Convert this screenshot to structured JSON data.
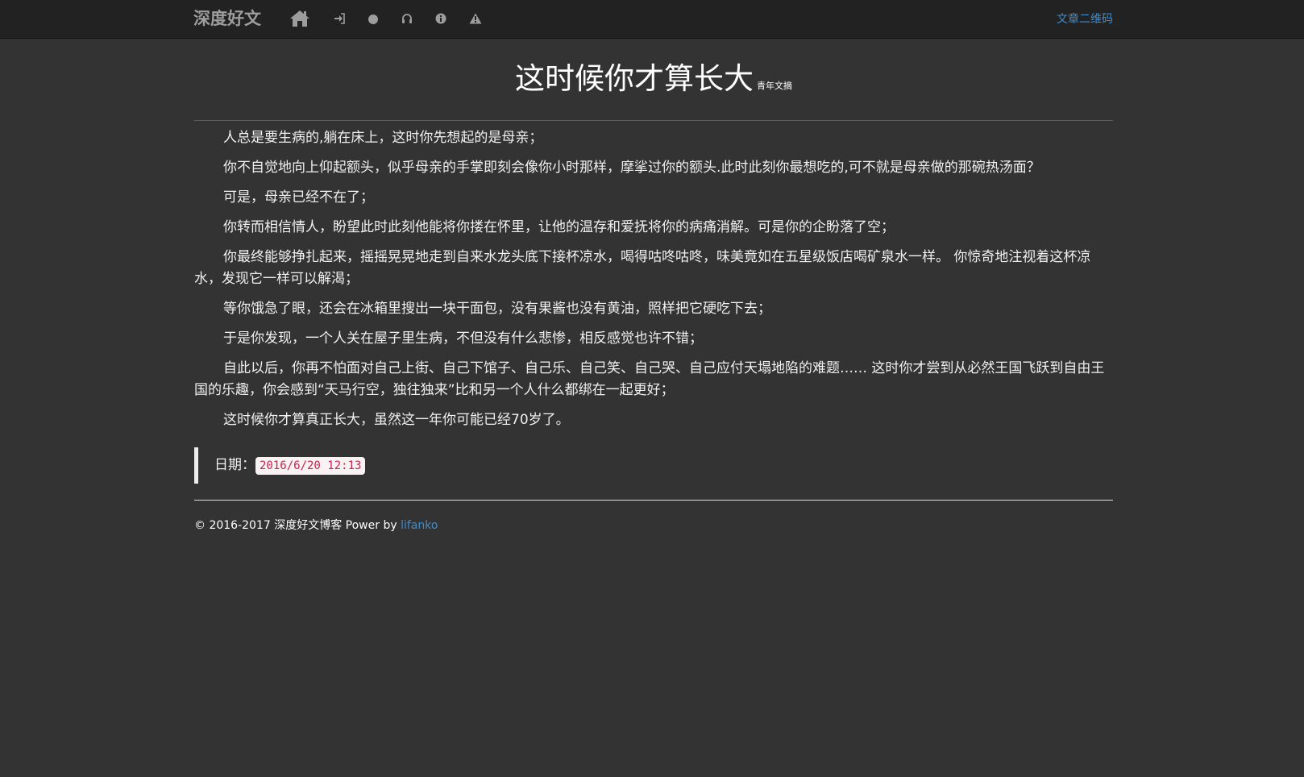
{
  "nav": {
    "brand": "深度好文",
    "icons": [
      "home-icon",
      "sign-in-icon",
      "circle-icon",
      "headphones-icon",
      "info-icon",
      "warning-icon"
    ],
    "right_link": "文章二维码"
  },
  "article": {
    "title": "这时候你才算长大",
    "source": "青年文摘",
    "paragraphs": [
      "人总是要生病的,躺在床上，这时你先想起的是母亲；",
      "你不自觉地向上仰起额头，似乎母亲的手掌即刻会像你小时那样，摩挲过你的额头.此时此刻你最想吃的,可不就是母亲做的那碗热汤面？",
      "可是，母亲已经不在了；",
      "你转而相信情人，盼望此时此刻他能将你搂在怀里，让他的温存和爱抚将你的病痛消解。可是你的企盼落了空；",
      "你最终能够挣扎起来，摇摇晃晃地走到自来水龙头底下接杯凉水，喝得咕咚咕咚，味美竟如在五星级饭店喝矿泉水一样。 你惊奇地注视着这杯凉水，发现它一样可以解渴；",
      "等你饿急了眼，还会在冰箱里搜出一块干面包，没有果酱也没有黄油，照样把它硬吃下去；",
      "于是你发现，一个人关在屋子里生病，不但没有什么悲惨，相反感觉也许不错；",
      "自此以后，你再不怕面对自己上街、自己下馆子、自己乐、自己笑、自己哭、自己应付天塌地陷的难题…… 这时你才尝到从必然王国飞跃到自由王国的乐趣，你会感到“天马行空，独往独来”比和另一个人什么都绑在一起更好；",
      "这时候你才算真正长大，虽然这一年你可能已经70岁了。"
    ],
    "date_label": "日期：",
    "date_value": "2016/6/20 12:13"
  },
  "footer": {
    "copyright": "© 2016-2017 深度好文博客 Power by ",
    "author_link": "lifanko"
  },
  "colors": {
    "background": "#333333",
    "navbar": "#222222",
    "link": "#428bca",
    "code_text": "#c7254e",
    "code_bg": "#f9f2f4"
  }
}
